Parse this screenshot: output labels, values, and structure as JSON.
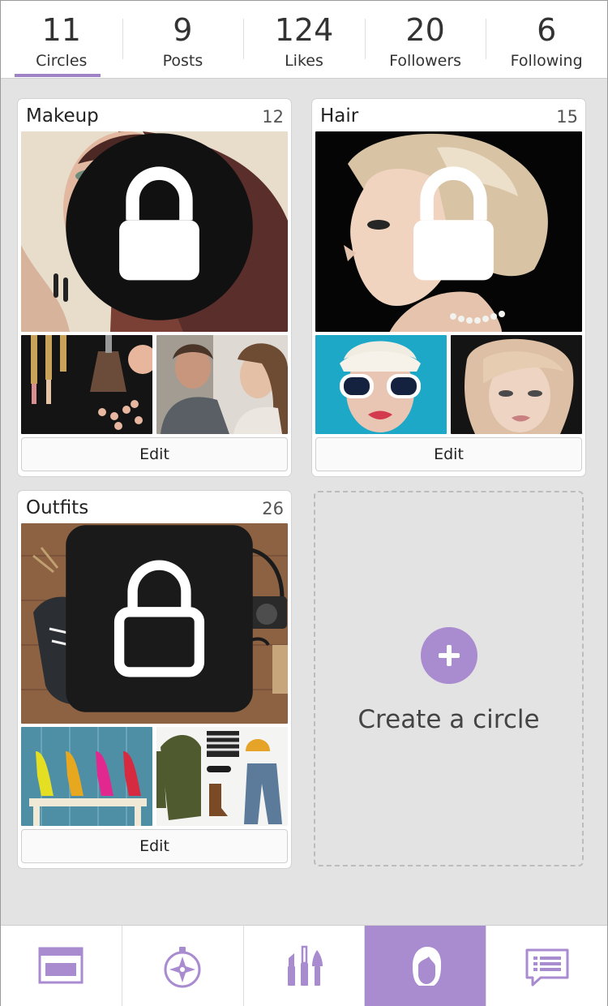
{
  "colors": {
    "accent": "#a98bd0",
    "indicator": "#9f83c6",
    "background": "#e3e3e3"
  },
  "stats": [
    {
      "value": "11",
      "label": "Circles",
      "active": true
    },
    {
      "value": "9",
      "label": "Posts"
    },
    {
      "value": "124",
      "label": "Likes"
    },
    {
      "value": "20",
      "label": "Followers"
    },
    {
      "value": "6",
      "label": "Following"
    }
  ],
  "circles": [
    {
      "title": "Makeup",
      "count": "12",
      "edit_label": "Edit",
      "locked": true,
      "photos": [
        "woman-eye-makeup-photo",
        "makeup-brushes-photo",
        "woman-applying-makeup-photo"
      ]
    },
    {
      "title": "Hair",
      "count": "15",
      "edit_label": "Edit",
      "locked": true,
      "photos": [
        "blonde-updo-profile-photo",
        "woman-white-sunglasses-photo",
        "blonde-bob-haircut-photo"
      ]
    },
    {
      "title": "Outfits",
      "count": "26",
      "edit_label": "Edit",
      "locked": true,
      "photos": [
        "flatlay-sneakers-notebook-camera-photo",
        "colorful-high-heels-photo",
        "outfit-flatlay-jacket-jeans-photo"
      ]
    }
  ],
  "create_circle": {
    "label": "Create a circle",
    "icon": "plus-icon"
  },
  "nav": [
    {
      "icon": "feed-icon"
    },
    {
      "icon": "compass-icon"
    },
    {
      "icon": "makeup-icon"
    },
    {
      "icon": "profile-icon",
      "active": true
    },
    {
      "icon": "messages-icon"
    }
  ]
}
